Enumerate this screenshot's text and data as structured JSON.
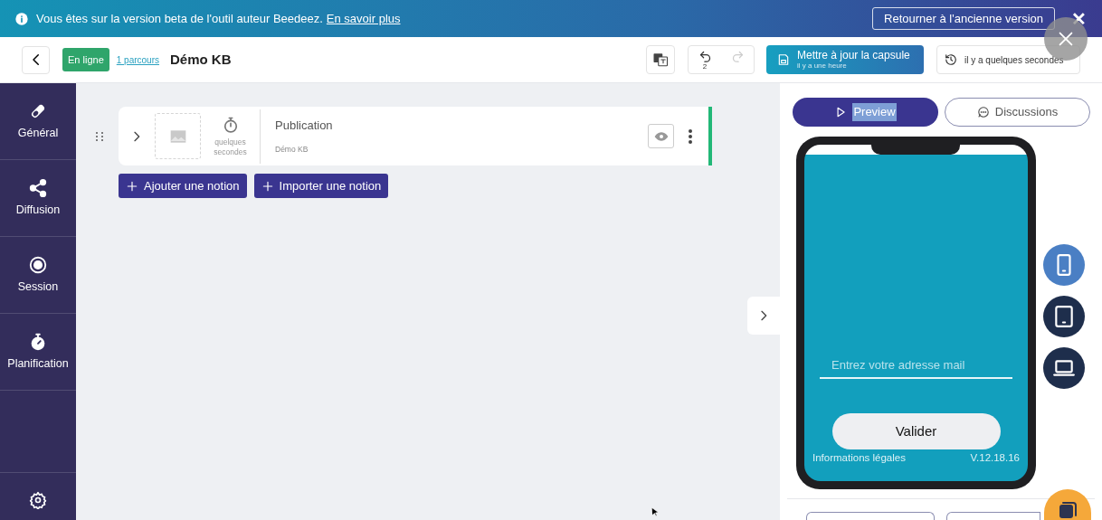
{
  "banner": {
    "message": "Vous êtes sur la version beta de l'outil auteur Beedeez.",
    "link": "En savoir plus",
    "button": "Retourner à l'ancienne version",
    "close": "✕"
  },
  "header": {
    "status": "En ligne",
    "parcours_link": "1 parcours",
    "title": "Démo KB",
    "undo_count": "2",
    "redo_disabled": true,
    "save": {
      "label": "Mettre à jour la capsule",
      "sub": "il y a une heure"
    },
    "history": "il y a quelques secondes"
  },
  "sidebar": {
    "items": [
      {
        "label": "Général"
      },
      {
        "label": "Diffusion"
      },
      {
        "label": "Session"
      },
      {
        "label": "Planification"
      }
    ]
  },
  "notion": {
    "duration": "quelques secondes",
    "title": "Publication",
    "subtitle": "Démo KB"
  },
  "actions": [
    "Ajouter une notion",
    "Importer une notion"
  ],
  "preview": {
    "tabs": [
      {
        "label": "Preview",
        "selected": true
      },
      {
        "label": "Discussions",
        "selected": false
      }
    ],
    "devices": [
      {
        "kind": "phone",
        "selected": true
      },
      {
        "kind": "tablet",
        "selected": false
      },
      {
        "kind": "laptop",
        "selected": false
      }
    ],
    "phone": {
      "placeholder": "Entrez votre adresse mail",
      "button": "Valider",
      "legal": "Informations légales",
      "version": "V.12.18.16"
    }
  }
}
